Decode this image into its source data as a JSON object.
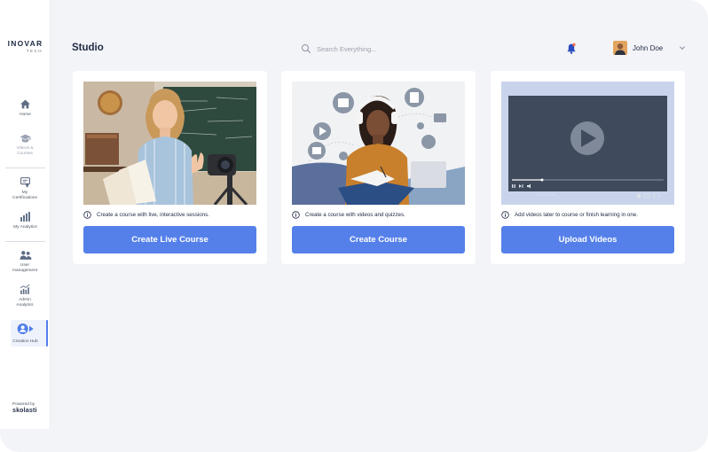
{
  "brand": {
    "name": "INOVAR",
    "sub": "TECH"
  },
  "sidebar": {
    "items": [
      {
        "label": "Home"
      },
      {
        "label": "Videos & Courses"
      },
      {
        "label": "My Certifications"
      },
      {
        "label": "My Analytics"
      },
      {
        "label": "User management"
      },
      {
        "label": "Admin Analytics"
      },
      {
        "label": "Creation Hub"
      }
    ],
    "active_item": "Creation Hub",
    "powered_by": "Powered by",
    "powered_brand": "skolasti"
  },
  "header": {
    "title": "Studio",
    "search_placeholder": "Search Everything...",
    "user_name": "John Doe"
  },
  "cards": [
    {
      "description": "Create a course with live, interactive sessions.",
      "button": "Create Live Course"
    },
    {
      "description": "Create a course with videos and quizzes.",
      "button": "Create Course"
    },
    {
      "description": "Add videos later to course or finish learning in one.",
      "button": "Upload Videos"
    }
  ],
  "video_player": {
    "time": "01:30 / 10:00"
  },
  "colors": {
    "accent": "#5580ea",
    "background": "#f3f4f7",
    "text": "#1f2a44",
    "notification": "#ef6c4a"
  }
}
